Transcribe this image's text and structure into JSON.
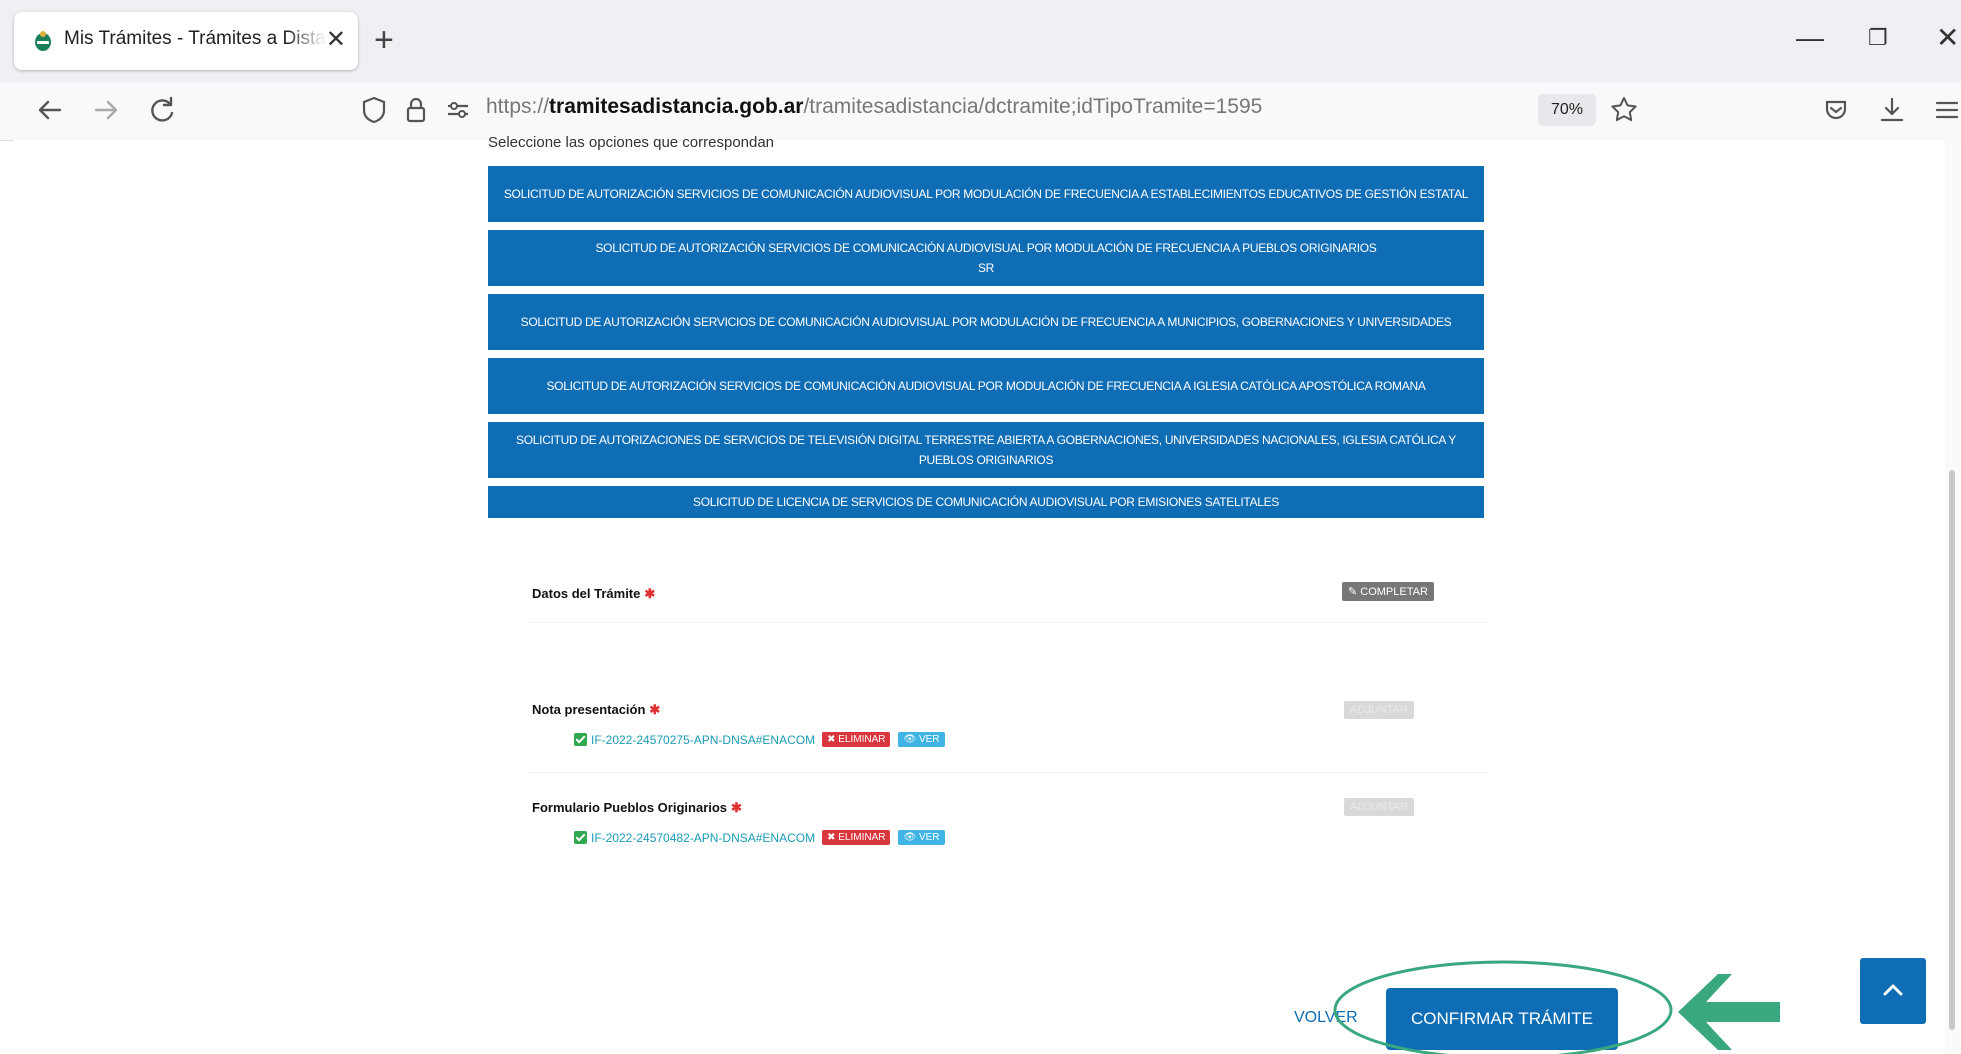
{
  "browser": {
    "tab_title": "Mis Trámites - Trámites a Distancia",
    "tab_close": "✕",
    "new_tab": "+",
    "window_controls": {
      "minimize": "—",
      "restore": "❐",
      "close": "✕"
    },
    "url_prefix": "https://",
    "url_host": "tramitesadistancia.gob.ar",
    "url_path": "/tramitesadistancia/dctramite;idTipoTramite=1595",
    "zoom": "70%",
    "icons": [
      "arrow-left-icon",
      "arrow-right-icon",
      "reload-icon",
      "shield-icon",
      "lock-icon",
      "permissions-icon",
      "star-icon",
      "pocket-icon",
      "download-icon",
      "menu-icon"
    ]
  },
  "form": {
    "instruction": "Seleccione las opciones que correspondan",
    "options": [
      "SOLICITUD DE AUTORIZACIÓN SERVICIOS DE COMUNICACIÓN AUDIOVISUAL POR MODULACIÓN DE FRECUENCIA A ESTABLECIMIENTOS EDUCATIVOS DE GESTIÓN ESTATAL",
      "SOLICITUD DE AUTORIZACIÓN SERVICIOS DE COMUNICACIÓN AUDIOVISUAL POR MODULACIÓN DE FRECUENCIA A PUEBLOS ORIGINARIOS",
      "SOLICITUD DE AUTORIZACIÓN SERVICIOS DE COMUNICACIÓN AUDIOVISUAL POR MODULACIÓN DE FRECUENCIA A MUNICIPIOS, GOBERNACIONES Y UNIVERSIDADES",
      "SOLICITUD DE AUTORIZACIÓN SERVICIOS DE COMUNICACIÓN AUDIOVISUAL POR MODULACIÓN DE FRECUENCIA A IGLESIA CATÓLICA APOSTÓLICA ROMANA",
      "SOLICITUD DE AUTORIZACIONES DE SERVICIOS DE TELEVISIÓN DIGITAL TERRESTRE ABIERTA A GOBERNACIONES, UNIVERSIDADES NACIONALES, IGLESIA CATÓLICA Y PUEBLOS ORIGINARIOS",
      "SOLICITUD DE LICENCIA DE SERVICIOS DE COMUNICACIÓN AUDIOVISUAL POR EMISIONES SATELITALES"
    ],
    "option2_suffix": "SR",
    "requirements": {
      "datos": {
        "label": "Datos del Trámite",
        "required_mark": "✱",
        "action": "✎ COMPLETAR"
      },
      "nota": {
        "label": "Nota presentación",
        "required_mark": "✱",
        "action": "ADJUNTAR",
        "file": "IF-2022-24570275-APN-DNSA#ENACOM",
        "delete": "✖ ELIMINAR",
        "view": "👁 VER"
      },
      "formulario": {
        "label": "Formulario Pueblos Originarios",
        "required_mark": "✱",
        "action": "ADJUNTAR",
        "file": "IF-2022-24570482-APN-DNSA#ENACOM",
        "delete": "✖ ELIMINAR",
        "view": "👁 VER"
      }
    },
    "volver": "VOLVER",
    "confirm": "CONFIRMAR TRÁMITE"
  },
  "colors": {
    "primary": "#0f6db5",
    "callout": "#3aa87f",
    "danger": "#d9363e",
    "info": "#3fb4e5",
    "required": "#e03131"
  }
}
